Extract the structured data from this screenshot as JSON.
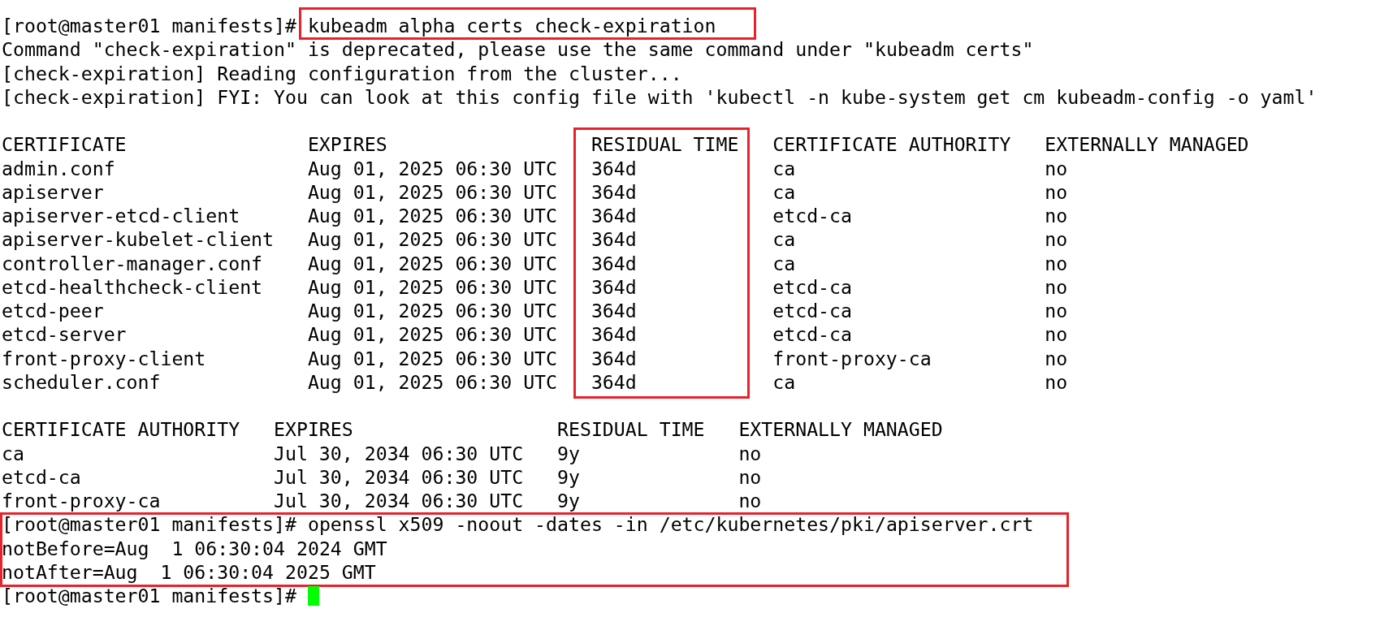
{
  "terminal": {
    "blocks": [
      {
        "kind": "command",
        "prompt": "[root@master01 manifests]#",
        "command": "kubeadm alpha certs check-expiration",
        "command_boxed": true,
        "block_boxed": false,
        "cursor": false,
        "output": [
          "Command \"check-expiration\" is deprecated, please use the same command under \"kubeadm certs\"",
          "[check-expiration] Reading configuration from the cluster...",
          "[check-expiration] FYI: You can look at this config file with 'kubectl -n kube-system get cm kubeadm-config -o yaml'"
        ]
      },
      {
        "kind": "blank"
      },
      {
        "kind": "table",
        "columns": [
          {
            "header": "CERTIFICATE",
            "highlighted": false
          },
          {
            "header": "EXPIRES",
            "highlighted": false
          },
          {
            "header": "RESIDUAL TIME",
            "highlighted": true
          },
          {
            "header": "CERTIFICATE AUTHORITY",
            "highlighted": false
          },
          {
            "header": "EXTERNALLY MANAGED",
            "highlighted": false
          }
        ],
        "rows": [
          [
            "admin.conf",
            "Aug 01, 2025 06:30 UTC",
            "364d",
            "ca",
            "no"
          ],
          [
            "apiserver",
            "Aug 01, 2025 06:30 UTC",
            "364d",
            "ca",
            "no"
          ],
          [
            "apiserver-etcd-client",
            "Aug 01, 2025 06:30 UTC",
            "364d",
            "etcd-ca",
            "no"
          ],
          [
            "apiserver-kubelet-client",
            "Aug 01, 2025 06:30 UTC",
            "364d",
            "ca",
            "no"
          ],
          [
            "controller-manager.conf",
            "Aug 01, 2025 06:30 UTC",
            "364d",
            "ca",
            "no"
          ],
          [
            "etcd-healthcheck-client",
            "Aug 01, 2025 06:30 UTC",
            "364d",
            "etcd-ca",
            "no"
          ],
          [
            "etcd-peer",
            "Aug 01, 2025 06:30 UTC",
            "364d",
            "etcd-ca",
            "no"
          ],
          [
            "etcd-server",
            "Aug 01, 2025 06:30 UTC",
            "364d",
            "etcd-ca",
            "no"
          ],
          [
            "front-proxy-client",
            "Aug 01, 2025 06:30 UTC",
            "364d",
            "front-proxy-ca",
            "no"
          ],
          [
            "scheduler.conf",
            "Aug 01, 2025 06:30 UTC",
            "364d",
            "ca",
            "no"
          ]
        ]
      },
      {
        "kind": "blank"
      },
      {
        "kind": "table",
        "columns": [
          {
            "header": "CERTIFICATE AUTHORITY",
            "highlighted": false
          },
          {
            "header": "EXPIRES",
            "highlighted": false
          },
          {
            "header": "RESIDUAL TIME",
            "highlighted": false
          },
          {
            "header": "EXTERNALLY MANAGED",
            "highlighted": false
          }
        ],
        "rows": [
          [
            "ca",
            "Jul 30, 2034 06:30 UTC",
            "9y",
            "no"
          ],
          [
            "etcd-ca",
            "Jul 30, 2034 06:30 UTC",
            "9y",
            "no"
          ],
          [
            "front-proxy-ca",
            "Jul 30, 2034 06:30 UTC",
            "9y",
            "no"
          ]
        ]
      },
      {
        "kind": "command",
        "prompt": "[root@master01 manifests]#",
        "command": "openssl x509 -noout -dates -in /etc/kubernetes/pki/apiserver.crt",
        "command_boxed": false,
        "block_boxed": true,
        "cursor": false,
        "output": [
          "notBefore=Aug  1 06:30:04 2024 GMT",
          "notAfter=Aug  1 06:30:04 2025 GMT"
        ]
      },
      {
        "kind": "command",
        "prompt": "[root@master01 manifests]#",
        "command_boxed": false,
        "block_boxed": false,
        "cursor": true
      }
    ]
  }
}
